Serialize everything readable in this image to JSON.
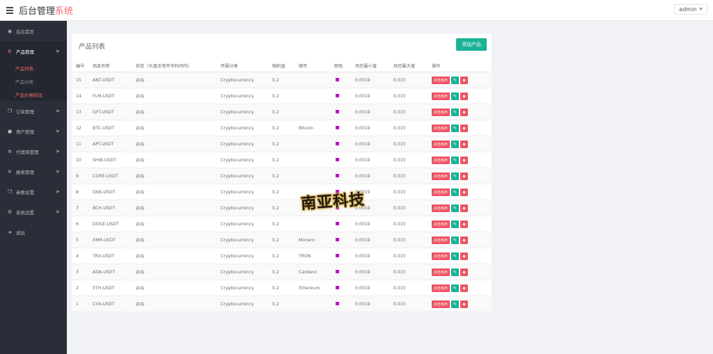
{
  "header": {
    "title_main": "后台管理",
    "title_accent": "系统",
    "user": "admin"
  },
  "sidebar": {
    "items": [
      {
        "label": "后台首页",
        "icon": "dashboard-icon"
      },
      {
        "label": "产品管理",
        "icon": "bitcoin-icon",
        "active": true,
        "children": [
          {
            "label": "产品列表"
          },
          {
            "label": "产品分类"
          },
          {
            "label": "产品价格校设"
          }
        ]
      },
      {
        "label": "订单管理",
        "icon": "copy-icon"
      },
      {
        "label": "用户管理",
        "icon": "user-icon"
      },
      {
        "label": "代理商管理",
        "icon": "gear-icon"
      },
      {
        "label": "报表管理",
        "icon": "yen-icon"
      },
      {
        "label": "参数设置",
        "icon": "copy-icon"
      },
      {
        "label": "系统设置",
        "icon": "gears-icon"
      },
      {
        "label": "退出",
        "icon": "sign-out-icon"
      }
    ]
  },
  "card": {
    "title": "产品列表",
    "add_button": "添加产品"
  },
  "table": {
    "headers": [
      "编号",
      "商品名称",
      "状态（大盘正常开市时间内）",
      "所属分类",
      "随机值",
      "缩写",
      "颜色",
      "风控最小值",
      "风控最大值",
      "操作"
    ],
    "halt_label": "点击休市",
    "swatch_color": "#cc00cc",
    "rows": [
      {
        "id": "15",
        "name": "ANT-USDT",
        "status": "开市",
        "category": "Cryptocurrency",
        "random": "0.2",
        "abbr": "",
        "min": "0.0019",
        "max": "0.015"
      },
      {
        "id": "14",
        "name": "FLM-USDT",
        "status": "开市",
        "category": "Cryptocurrency",
        "random": "0.2",
        "abbr": "",
        "min": "0.0019",
        "max": "0.015"
      },
      {
        "id": "13",
        "name": "GFT-USDT",
        "status": "开市",
        "category": "Cryptocurrency",
        "random": "0.2",
        "abbr": "",
        "min": "0.0019",
        "max": "0.015"
      },
      {
        "id": "12",
        "name": "BTC-USDT",
        "status": "开市",
        "category": "Cryptocurrency",
        "random": "0.2",
        "abbr": "Bitcoin",
        "min": "0.0019",
        "max": "0.015"
      },
      {
        "id": "11",
        "name": "APT-USDT",
        "status": "开市",
        "category": "Cryptocurrency",
        "random": "0.2",
        "abbr": "",
        "min": "0.0019",
        "max": "0.015"
      },
      {
        "id": "10",
        "name": "SHIB-USDT",
        "status": "开市",
        "category": "Cryptocurrency",
        "random": "0.2",
        "abbr": "",
        "min": "0.0019",
        "max": "0.015"
      },
      {
        "id": "9",
        "name": "CORE-USDT",
        "status": "开市",
        "category": "Cryptocurrency",
        "random": "0.2",
        "abbr": "",
        "min": "0.0019",
        "max": "0.015"
      },
      {
        "id": "8",
        "name": "OKB-USDT",
        "status": "开市",
        "category": "Cryptocurrency",
        "random": "0.2",
        "abbr": "",
        "min": "0.0019",
        "max": "0.015"
      },
      {
        "id": "7",
        "name": "BCH-USDT",
        "status": "开市",
        "category": "Cryptocurrency",
        "random": "0.2",
        "abbr": "",
        "min": "0.0019",
        "max": "0.015"
      },
      {
        "id": "6",
        "name": "DOGE-USDT",
        "status": "开市",
        "category": "Cryptocurrency",
        "random": "0.2",
        "abbr": "",
        "min": "0.0019",
        "max": "0.015"
      },
      {
        "id": "5",
        "name": "XMR-USDT",
        "status": "开市",
        "category": "Cryptocurrency",
        "random": "0.2",
        "abbr": "Monero",
        "min": "0.0019",
        "max": "0.015"
      },
      {
        "id": "4",
        "name": "TRX-USDT",
        "status": "开市",
        "category": "Cryptocurrency",
        "random": "0.2",
        "abbr": "TRON",
        "min": "0.0019",
        "max": "0.015"
      },
      {
        "id": "3",
        "name": "ADA-USDT",
        "status": "开市",
        "category": "Cryptocurrency",
        "random": "0.2",
        "abbr": "Cardano",
        "min": "0.0019",
        "max": "0.015"
      },
      {
        "id": "2",
        "name": "ETH-USDT",
        "status": "开市",
        "category": "Cryptocurrency",
        "random": "0.2",
        "abbr": "Ethereum",
        "min": "0.0019",
        "max": "0.015"
      },
      {
        "id": "1",
        "name": "CVX-USDT",
        "status": "开市",
        "category": "Cryptocurrency",
        "random": "0.2",
        "abbr": "",
        "min": "0.0019",
        "max": "0.015"
      }
    ]
  },
  "watermark": "南亚科技"
}
